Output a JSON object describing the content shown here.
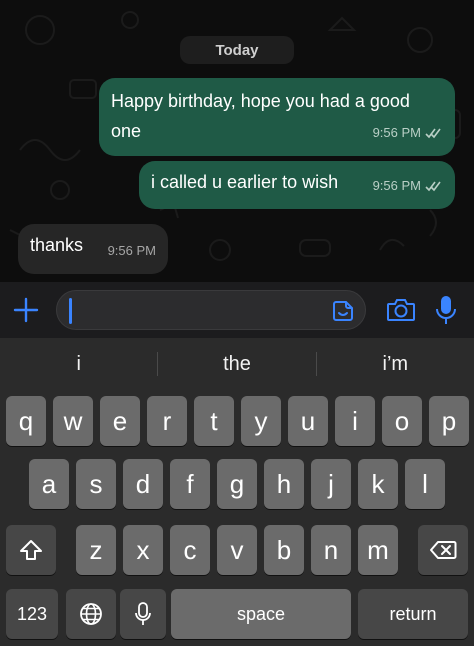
{
  "chat": {
    "date_label": "Today",
    "messages": [
      {
        "direction": "out",
        "text_line1": "Happy birthday, hope you had a good",
        "text_line2": "one",
        "time": "9:56 PM"
      },
      {
        "direction": "out",
        "text": "i called u earlier to wish",
        "time": "9:56 PM"
      },
      {
        "direction": "in",
        "text": "thanks",
        "time": "9:56 PM"
      }
    ]
  },
  "input": {
    "value": "",
    "icons": [
      "plus-icon",
      "sticker-icon",
      "camera-icon",
      "microphone-icon"
    ]
  },
  "keyboard": {
    "suggestions": [
      "i",
      "the",
      "i’m"
    ],
    "row1": [
      "q",
      "w",
      "e",
      "r",
      "t",
      "y",
      "u",
      "i",
      "o",
      "p"
    ],
    "row2": [
      "a",
      "s",
      "d",
      "f",
      "g",
      "h",
      "j",
      "k",
      "l"
    ],
    "row3": [
      "z",
      "x",
      "c",
      "v",
      "b",
      "n",
      "m"
    ],
    "numbers_key": "123",
    "space_key": "space",
    "return_key": "return",
    "icons": [
      "shift-icon",
      "backspace-icon",
      "globe-icon",
      "dictation-mic-icon"
    ]
  },
  "colors": {
    "outgoing_bubble": "#1f5a46",
    "incoming_bubble": "#262626",
    "accent": "#3a84ff",
    "key": "#6b6b6b",
    "function_key": "#474747"
  }
}
